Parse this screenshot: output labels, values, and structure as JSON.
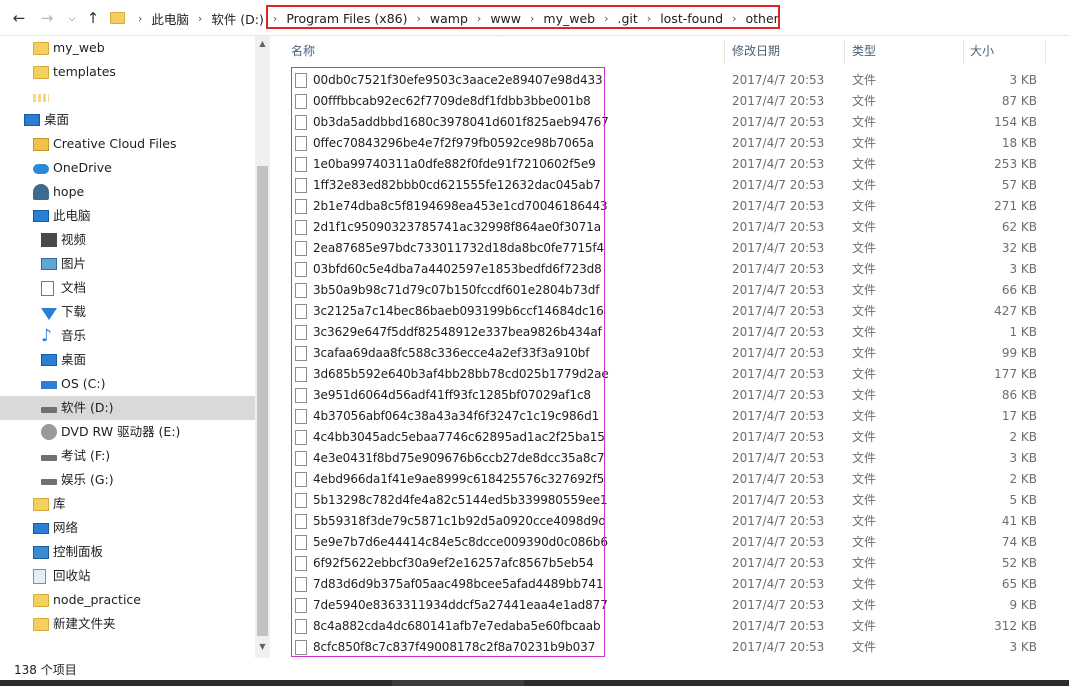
{
  "address_bar": {
    "crumbs": [
      "此电脑",
      "软件 (D:)",
      "Program Files (x86)",
      "wamp",
      "www",
      "my_web",
      ".git",
      "lost-found",
      "other"
    ]
  },
  "nav": {
    "items": [
      {
        "label": "my_web",
        "icon": "folder-icon"
      },
      {
        "label": "templates",
        "icon": "folder-icon"
      },
      {
        "label": "",
        "icon": "folder-icon"
      },
      {
        "label": "桌面",
        "icon": "desktop-icon"
      },
      {
        "label": "Creative Cloud Files",
        "icon": "creative-cloud-icon"
      },
      {
        "label": "OneDrive",
        "icon": "cloud-icon"
      },
      {
        "label": "hope",
        "icon": "user-icon"
      },
      {
        "label": "此电脑",
        "icon": "computer-icon"
      },
      {
        "label": "视频",
        "icon": "video-icon"
      },
      {
        "label": "图片",
        "icon": "picture-icon"
      },
      {
        "label": "文档",
        "icon": "document-icon"
      },
      {
        "label": "下载",
        "icon": "download-icon"
      },
      {
        "label": "音乐",
        "icon": "music-icon"
      },
      {
        "label": "桌面",
        "icon": "desktop-icon"
      },
      {
        "label": "OS (C:)",
        "icon": "os-drive-icon"
      },
      {
        "label": "软件 (D:)",
        "icon": "drive-icon"
      },
      {
        "label": "DVD RW 驱动器 (E:)",
        "icon": "dvd-drive-icon"
      },
      {
        "label": "考试 (F:)",
        "icon": "drive-icon"
      },
      {
        "label": "娱乐 (G:)",
        "icon": "drive-icon"
      },
      {
        "label": "库",
        "icon": "library-icon"
      },
      {
        "label": "网络",
        "icon": "network-icon"
      },
      {
        "label": "控制面板",
        "icon": "control-panel-icon"
      },
      {
        "label": "回收站",
        "icon": "recycle-bin-icon"
      },
      {
        "label": "node_practice",
        "icon": "folder-icon"
      },
      {
        "label": "新建文件夹",
        "icon": "folder-icon"
      }
    ],
    "selected_label": "软件 (D:)"
  },
  "columns": {
    "name": "名称",
    "date": "修改日期",
    "type": "类型",
    "size": "大小"
  },
  "files": [
    {
      "name": "00db0c7521f30efe9503c3aace2e89407e98d433",
      "date": "2017/4/7 20:53",
      "type": "文件",
      "size": "3 KB"
    },
    {
      "name": "00fffbbcab92ec62f7709de8df1fdbb3bbe001b8",
      "date": "2017/4/7 20:53",
      "type": "文件",
      "size": "87 KB"
    },
    {
      "name": "0b3da5addbbd1680c3978041d601f825aeb94767",
      "date": "2017/4/7 20:53",
      "type": "文件",
      "size": "154 KB"
    },
    {
      "name": "0ffec70843296be4e7f2f979fb0592ce98b7065a",
      "date": "2017/4/7 20:53",
      "type": "文件",
      "size": "18 KB"
    },
    {
      "name": "1e0ba99740311a0dfe882f0fde91f7210602f5e9",
      "date": "2017/4/7 20:53",
      "type": "文件",
      "size": "253 KB"
    },
    {
      "name": "1ff32e83ed82bbb0cd621555fe12632dac045ab7",
      "date": "2017/4/7 20:53",
      "type": "文件",
      "size": "57 KB"
    },
    {
      "name": "2b1e74dba8c5f8194698ea453e1cd70046186443",
      "date": "2017/4/7 20:53",
      "type": "文件",
      "size": "271 KB"
    },
    {
      "name": "2d1f1c95090323785741ac32998f864ae0f3071a",
      "date": "2017/4/7 20:53",
      "type": "文件",
      "size": "62 KB"
    },
    {
      "name": "2ea87685e97bdc733011732d18da8bc0fe7715f4",
      "date": "2017/4/7 20:53",
      "type": "文件",
      "size": "32 KB"
    },
    {
      "name": "03bfd60c5e4dba7a4402597e1853bedfd6f723d8",
      "date": "2017/4/7 20:53",
      "type": "文件",
      "size": "3 KB"
    },
    {
      "name": "3b50a9b98c71d79c07b150fccdf601e2804b73df",
      "date": "2017/4/7 20:53",
      "type": "文件",
      "size": "66 KB"
    },
    {
      "name": "3c2125a7c14bec86baeb093199b6ccf14684dc16",
      "date": "2017/4/7 20:53",
      "type": "文件",
      "size": "427 KB"
    },
    {
      "name": "3c3629e647f5ddf82548912e337bea9826b434af",
      "date": "2017/4/7 20:53",
      "type": "文件",
      "size": "1 KB"
    },
    {
      "name": "3cafaa69daa8fc588c336ecce4a2ef33f3a910bf",
      "date": "2017/4/7 20:53",
      "type": "文件",
      "size": "99 KB"
    },
    {
      "name": "3d685b592e640b3af4bb28bb78cd025b1779d2ae",
      "date": "2017/4/7 20:53",
      "type": "文件",
      "size": "177 KB"
    },
    {
      "name": "3e951d6064d56adf41ff93fc1285bf07029af1c8",
      "date": "2017/4/7 20:53",
      "type": "文件",
      "size": "86 KB"
    },
    {
      "name": "4b37056abf064c38a43a34f6f3247c1c19c986d1",
      "date": "2017/4/7 20:53",
      "type": "文件",
      "size": "17 KB"
    },
    {
      "name": "4c4bb3045adc5ebaa7746c62895ad1ac2f25ba15",
      "date": "2017/4/7 20:53",
      "type": "文件",
      "size": "2 KB"
    },
    {
      "name": "4e3e0431f8bd75e909676b6ccb27de8dcc35a8c7",
      "date": "2017/4/7 20:53",
      "type": "文件",
      "size": "3 KB"
    },
    {
      "name": "4ebd966da1f41e9ae8999c618425576c327692f5",
      "date": "2017/4/7 20:53",
      "type": "文件",
      "size": "2 KB"
    },
    {
      "name": "5b13298c782d4fe4a82c5144ed5b339980559ee1",
      "date": "2017/4/7 20:53",
      "type": "文件",
      "size": "5 KB"
    },
    {
      "name": "5b59318f3de79c5871c1b92d5a0920cce4098d9d",
      "date": "2017/4/7 20:53",
      "type": "文件",
      "size": "41 KB"
    },
    {
      "name": "5e9e7b7d6e44414c84e5c8dcce009390d0c086b6",
      "date": "2017/4/7 20:53",
      "type": "文件",
      "size": "74 KB"
    },
    {
      "name": "6f92f5622ebbcf30a9ef2e16257afc8567b5eb54",
      "date": "2017/4/7 20:53",
      "type": "文件",
      "size": "52 KB"
    },
    {
      "name": "7d83d6d9b375af05aac498bcee5afad4489bb741",
      "date": "2017/4/7 20:53",
      "type": "文件",
      "size": "65 KB"
    },
    {
      "name": "7de5940e8363311934ddcf5a27441eaa4e1ad877",
      "date": "2017/4/7 20:53",
      "type": "文件",
      "size": "9 KB"
    },
    {
      "name": "8c4a882cda4dc680141afb7e7edaba5e60fbcaab",
      "date": "2017/4/7 20:53",
      "type": "文件",
      "size": "312 KB"
    },
    {
      "name": "8cfc850f8c7c837f49008178c2f8a70231b9b037",
      "date": "2017/4/7 20:53",
      "type": "文件",
      "size": "3 KB"
    }
  ],
  "status": {
    "item_count": "138 个项目"
  },
  "colors": {
    "highlight_path": "#e02424",
    "highlight_names": "#cc33cc",
    "accent": "#2a7fd4"
  }
}
